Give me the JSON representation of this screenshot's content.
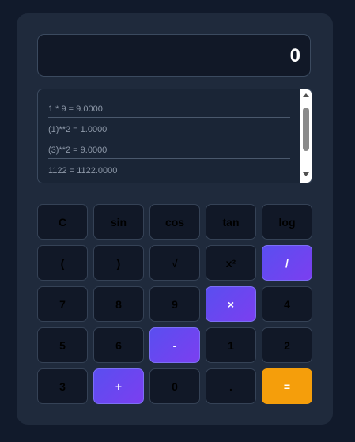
{
  "display": {
    "value": "0"
  },
  "history": {
    "items": [
      "1 * 9 = 9.0000",
      "(1)**2 = 1.0000",
      "(3)**2 = 9.0000",
      "1122 = 1122.0000"
    ]
  },
  "keys": [
    {
      "label": "C",
      "type": "func",
      "name": "clear-button"
    },
    {
      "label": "sin",
      "type": "func",
      "name": "sin-button"
    },
    {
      "label": "cos",
      "type": "func",
      "name": "cos-button"
    },
    {
      "label": "tan",
      "type": "func",
      "name": "tan-button"
    },
    {
      "label": "log",
      "type": "func",
      "name": "log-button"
    },
    {
      "label": "(",
      "type": "func",
      "name": "open-paren-button"
    },
    {
      "label": ")",
      "type": "func",
      "name": "close-paren-button"
    },
    {
      "label": "√",
      "type": "func",
      "name": "sqrt-button"
    },
    {
      "label": "x²",
      "type": "func",
      "name": "square-button"
    },
    {
      "label": "/",
      "type": "op",
      "name": "divide-button"
    },
    {
      "label": "7",
      "type": "num",
      "name": "digit-7-button"
    },
    {
      "label": "8",
      "type": "num",
      "name": "digit-8-button"
    },
    {
      "label": "9",
      "type": "num",
      "name": "digit-9-button"
    },
    {
      "label": "×",
      "type": "op",
      "name": "multiply-button"
    },
    {
      "label": "4",
      "type": "num",
      "name": "digit-4-button"
    },
    {
      "label": "5",
      "type": "num",
      "name": "digit-5-button"
    },
    {
      "label": "6",
      "type": "num",
      "name": "digit-6-button"
    },
    {
      "label": "-",
      "type": "op",
      "name": "subtract-button"
    },
    {
      "label": "1",
      "type": "num",
      "name": "digit-1-button"
    },
    {
      "label": "2",
      "type": "num",
      "name": "digit-2-button"
    },
    {
      "label": "3",
      "type": "num",
      "name": "digit-3-button"
    },
    {
      "label": "+",
      "type": "op",
      "name": "add-button"
    },
    {
      "label": "0",
      "type": "num",
      "name": "digit-0-button"
    },
    {
      "label": ".",
      "type": "num",
      "name": "decimal-button"
    },
    {
      "label": "=",
      "type": "eq",
      "name": "equals-button"
    }
  ],
  "colors": {
    "operator_gradient_start": "#5a4ef0",
    "operator_gradient_end": "#7b3ff0",
    "equals": "#f59e0b",
    "panel": "#1f2a3c",
    "background": "#111a2b"
  }
}
